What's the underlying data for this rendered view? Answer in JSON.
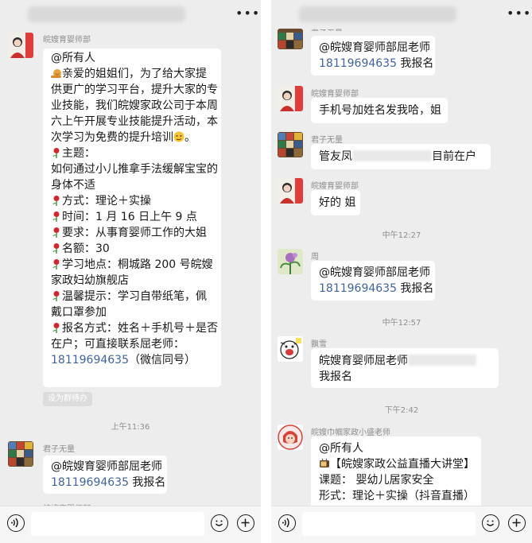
{
  "left": {
    "senders": {
      "s1": "皖嫂育婴师部",
      "s2": "君子无量",
      "s3": "皖嫂育婴师部"
    },
    "announce_lines": [
      "@所有人",
      "亲爱的姐姐们，为了给大家提",
      "供更广的学习平台，提升大家的专",
      "业技能，我们皖嫂家政公司于本周",
      "六上午开展专业技能提升活动，本",
      "次学习为免费的提升培训",
      "主题：",
      "如何通过小儿推拿手法缓解宝宝的",
      "身体不适",
      "方式：理论＋实操",
      "时间：1 月 16 日上午 9 点",
      "要求：从事育婴师工作的大姐",
      "名额：30",
      "学习地点：桐城路 200 号皖嫂",
      "家政妇幼旗舰店",
      "温馨提示：学习自带纸笔，佩",
      "戴口罩参加",
      "报名方式：姓名＋手机号＋是否",
      "在户；可直接联系屈老师：",
      "18119694635",
      "（微信同号）"
    ],
    "set_pill": "设为群待办",
    "time1": "上午11:36",
    "reply": {
      "line1": "@皖嫂育婴师部屈老师",
      "phone": "18119694635",
      "suffix": " 我报名"
    }
  },
  "right": {
    "partial_sender": "君子无量",
    "reply1": {
      "line1": "@皖嫂育婴师部屈老师",
      "phone": "18119694635",
      "suffix": " 我报名"
    },
    "sender_s2": "皖嫂育婴师部",
    "msg2": "手机号加姓名发我哈，姐",
    "sender_s3": "君子无量",
    "msg3_prefix": "管友凤",
    "msg3_suffix": "目前在户",
    "sender_s4": "皖嫂育婴师部",
    "msg4": "好的 姐",
    "time1": "中午12:27",
    "sender_s5": "周",
    "reply2": {
      "line1": "@皖嫂育婴师部屈老师",
      "phone": "18119694635",
      "suffix": " 我报名"
    },
    "time2": "中午12:57",
    "sender_s6": "飘雪",
    "msg6_line1": "皖嫂育婴师屈老师",
    "msg6_line2": "我报名",
    "time3": "下午2:42",
    "sender_s7": "皖嫂巾帼家政小盛老师",
    "msg7_lines": [
      "@所有人",
      "【皖嫂家政公益直播大讲堂】",
      "课题： 婴幼儿居家安全",
      "形式：理论＋实操（抖音直播）"
    ]
  },
  "colors": {
    "background": "#ededed",
    "bubble": "#ffffff",
    "phone_link": "#3f64a0",
    "meta_text": "#8e8e8e"
  },
  "icons": [
    "more-icon",
    "voice-icon",
    "emoji-icon",
    "plus-icon",
    "snail-emoji",
    "rose-emoji",
    "smirk-emoji",
    "tv-emoji"
  ]
}
